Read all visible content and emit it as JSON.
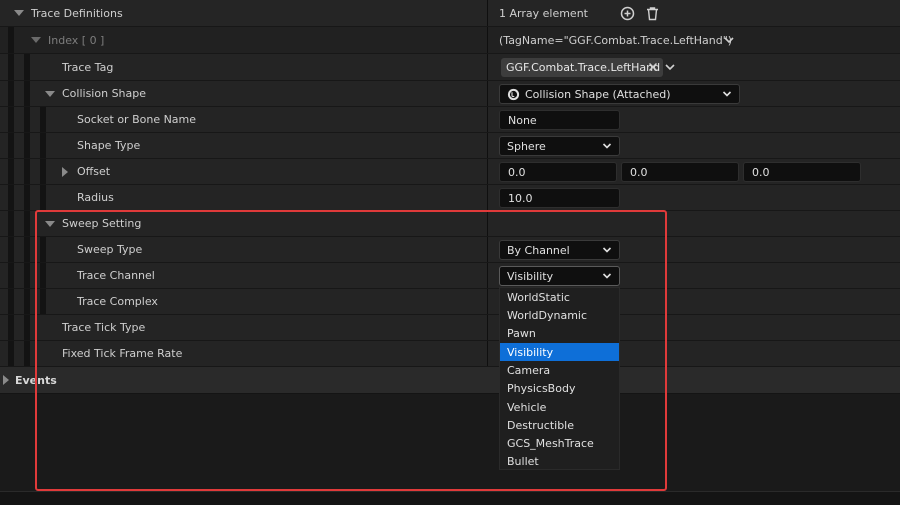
{
  "trace_definitions": {
    "label": "Trace Definitions",
    "array_count": "1 Array element",
    "index": {
      "label": "Index [ 0 ]",
      "value": "(TagName=\"GGF.Combat.Trace.LeftHand\")"
    },
    "trace_tag": {
      "label": "Trace Tag",
      "tag": "GGF.Combat.Trace.LeftHand"
    },
    "collision_shape": {
      "label": "Collision Shape",
      "value": "Collision Shape (Attached)"
    },
    "socket_or_bone_name": {
      "label": "Socket or Bone Name",
      "value": "None"
    },
    "shape_type": {
      "label": "Shape Type",
      "value": "Sphere"
    },
    "offset": {
      "label": "Offset",
      "x": "0.0",
      "y": "0.0",
      "z": "0.0"
    },
    "radius": {
      "label": "Radius",
      "value": "10.0"
    },
    "sweep_setting": {
      "label": "Sweep Setting"
    },
    "sweep_type": {
      "label": "Sweep Type",
      "value": "By Channel"
    },
    "trace_channel": {
      "label": "Trace Channel",
      "value": "Visibility"
    },
    "trace_complex": {
      "label": "Trace Complex"
    },
    "trace_tick_type": {
      "label": "Trace Tick Type"
    },
    "fixed_tick_frame_rate": {
      "label": "Fixed Tick Frame Rate"
    }
  },
  "events": {
    "label": "Events"
  },
  "channel_options": [
    "WorldStatic",
    "WorldDynamic",
    "Pawn",
    "Visibility",
    "Camera",
    "PhysicsBody",
    "Vehicle",
    "Destructible",
    "GCS_MeshTrace",
    "Bullet"
  ],
  "selected_channel": "Visibility",
  "colors": {
    "background": "#1a1a1a",
    "row": "#242424",
    "selection": "#0e6fd8",
    "highlight_box": "#e03a3a"
  }
}
